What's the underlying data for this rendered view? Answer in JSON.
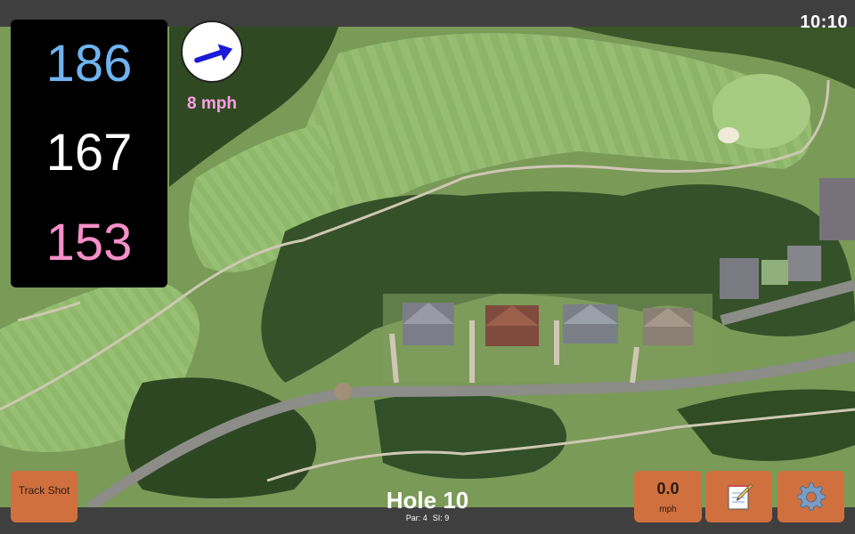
{
  "status": {
    "time": "10:10"
  },
  "distances": {
    "back": "186",
    "middle": "167",
    "front": "153"
  },
  "wind": {
    "speed_label": "8 mph",
    "direction_icon": "arrow-icon"
  },
  "hole": {
    "title": "Hole 10",
    "par_label": "Par: 4",
    "si_label": "SI: 9"
  },
  "buttons": {
    "track_shot": "Track Shot",
    "speed_value": "0.0",
    "speed_unit": "mph",
    "notes_icon": "notepad-icon",
    "settings_icon": "gear-icon"
  },
  "colors": {
    "back_distance": "#6fb3f2",
    "middle_distance": "#ffffff",
    "front_distance": "#f68fc9",
    "button_bg": "#d0703f",
    "wind_label": "#ff9ee6"
  }
}
